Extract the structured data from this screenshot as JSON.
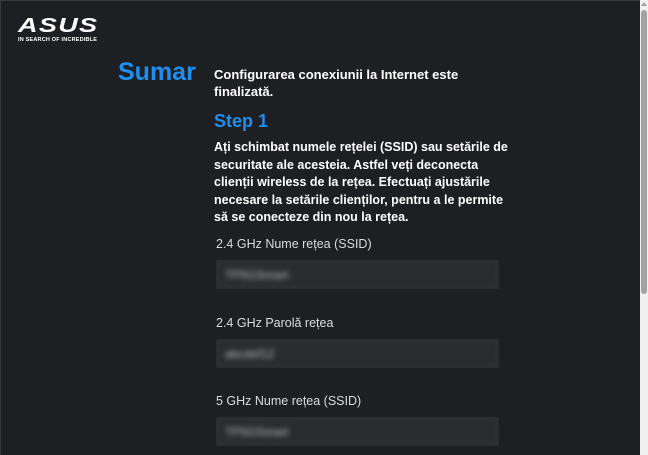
{
  "logo": {
    "brand": "ASUS",
    "tagline": "IN SEARCH OF INCREDIBLE"
  },
  "page": {
    "title": "Sumar",
    "summary": "Configurarea conexiunii la Internet este finalizată."
  },
  "step": {
    "title": "Step 1",
    "description": "Ați schimbat numele rețelei (SSID) sau setările de securitate ale acesteia. Astfel veți deconecta clienții wireless de la rețea. Efectuați ajustările necesare la setările clienților, pentru a le permite să se conecteze din nou la rețea."
  },
  "fields": [
    {
      "label": "2.4 GHz Nume rețea (SSID)",
      "value": "TP5GSmart"
    },
    {
      "label": "2.4 GHz Parolă rețea",
      "value": "abcdef12"
    },
    {
      "label": "5 GHz Nume rețea (SSID)",
      "value": "TP5GSmart"
    }
  ],
  "colors": {
    "background": "#1e1f22",
    "accent": "#1e8ff0",
    "text": "#ffffff"
  }
}
